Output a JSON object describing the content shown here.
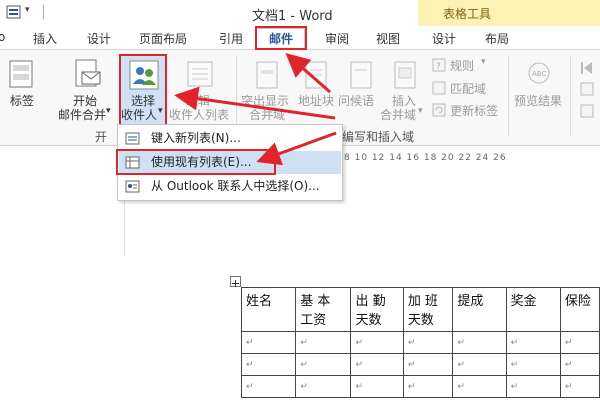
{
  "window": {
    "title": "文档1 - Word"
  },
  "table_tools": {
    "label": "表格工具"
  },
  "quick_access": {
    "dropdown": "▾"
  },
  "tabs": [
    {
      "label": "插入"
    },
    {
      "label": "设计"
    },
    {
      "label": "页面布局"
    },
    {
      "label": "引用"
    },
    {
      "label": "邮件"
    },
    {
      "label": "审阅"
    },
    {
      "label": "视图"
    },
    {
      "label": "设计"
    },
    {
      "label": "布局"
    }
  ],
  "ribbon": {
    "labels_button": "标签",
    "start_merge": {
      "line1": "开始",
      "line2": "邮件合并",
      "arrow": "▾"
    },
    "select_recipients": {
      "line1": "选择",
      "line2": "收件人",
      "arrow": "▾"
    },
    "edit_list": {
      "line1": "编辑",
      "line2": "收件人列表"
    },
    "highlight_fields": {
      "line1": "突出显示",
      "line2": "合并域"
    },
    "address_block": "地址块",
    "greeting_line": "问候语",
    "insert_field": {
      "line1": "插入",
      "line2": "合并域",
      "arrow": "▾"
    },
    "rules": "规则",
    "match_fields": "匹配域",
    "update_labels": "更新标签",
    "preview_results": "预览结果",
    "group_start_partial": "开",
    "group_write_insert": "编写和插入域"
  },
  "menu": {
    "items": [
      {
        "label": "键入新列表(N)..."
      },
      {
        "label": "使用现有列表(E)..."
      },
      {
        "label": "从 Outlook 联系人中选择(O)..."
      }
    ]
  },
  "ruler": {
    "marks": "8  10  12  14  16  18  20  22  24  26"
  },
  "table": {
    "header": [
      "姓名",
      "基 本 工资",
      "出 勤 天数",
      "加 班 天数",
      "提成",
      "奖金",
      "保险"
    ],
    "cell_mark": "↵",
    "rows": 3
  },
  "colors": {
    "accent": "#2b579a",
    "annotation": "#e0242c",
    "tool_tab": "#fcf2b4"
  }
}
